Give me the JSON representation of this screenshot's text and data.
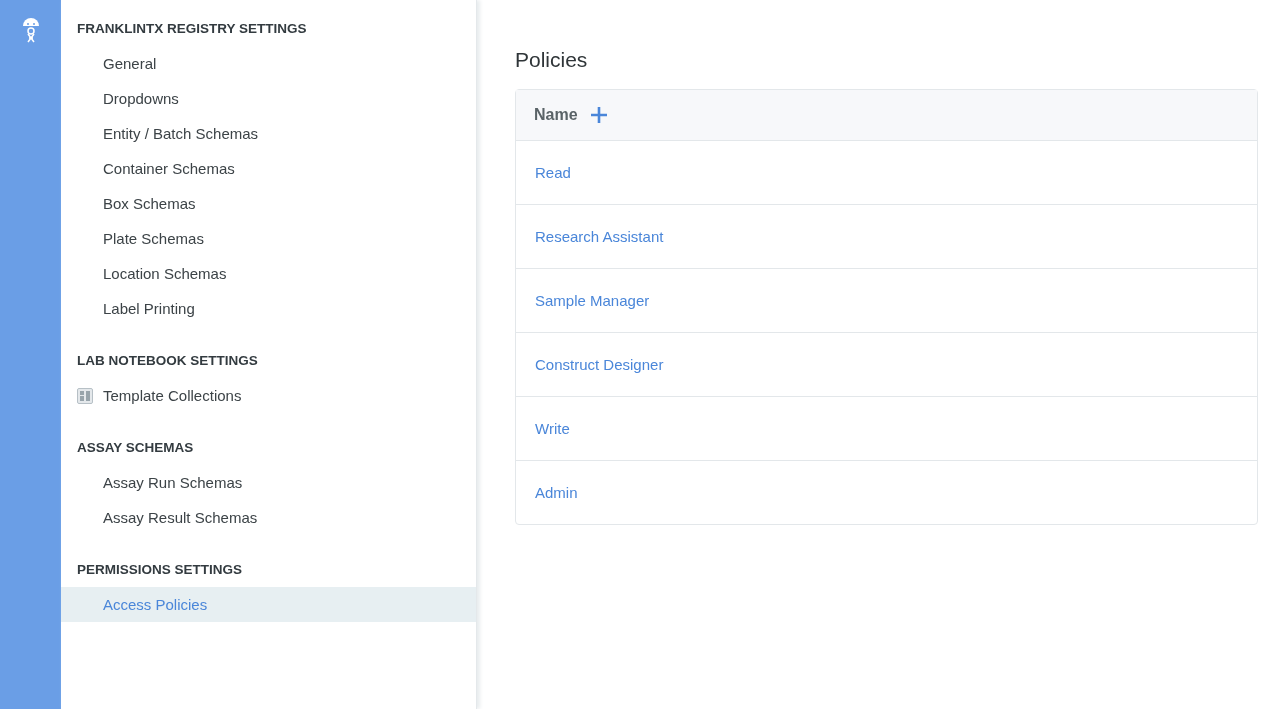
{
  "sidebar": {
    "sections": [
      {
        "heading": "FRANKLINTX REGISTRY SETTINGS",
        "items": [
          {
            "label": "General",
            "kind": "plain",
            "selected": false
          },
          {
            "label": "Dropdowns",
            "kind": "plain",
            "selected": false
          },
          {
            "label": "Entity / Batch Schemas",
            "kind": "plain",
            "selected": false
          },
          {
            "label": "Container Schemas",
            "kind": "plain",
            "selected": false
          },
          {
            "label": "Box Schemas",
            "kind": "plain",
            "selected": false
          },
          {
            "label": "Plate Schemas",
            "kind": "plain",
            "selected": false
          },
          {
            "label": "Location Schemas",
            "kind": "plain",
            "selected": false
          },
          {
            "label": "Label Printing",
            "kind": "plain",
            "selected": false
          }
        ]
      },
      {
        "heading": "LAB NOTEBOOK SETTINGS",
        "items": [
          {
            "label": "Template Collections",
            "kind": "template",
            "selected": false
          }
        ]
      },
      {
        "heading": "ASSAY SCHEMAS",
        "items": [
          {
            "label": "Assay Run Schemas",
            "kind": "plain",
            "selected": false
          },
          {
            "label": "Assay Result Schemas",
            "kind": "plain",
            "selected": false
          }
        ]
      },
      {
        "heading": "PERMISSIONS SETTINGS",
        "items": [
          {
            "label": "Access Policies",
            "kind": "plain",
            "selected": true
          }
        ]
      }
    ]
  },
  "main": {
    "title": "Policies",
    "table": {
      "column": "Name",
      "rows": [
        "Read",
        "Research Assistant",
        "Sample Manager",
        "Construct Designer",
        "Write",
        "Admin"
      ]
    }
  }
}
